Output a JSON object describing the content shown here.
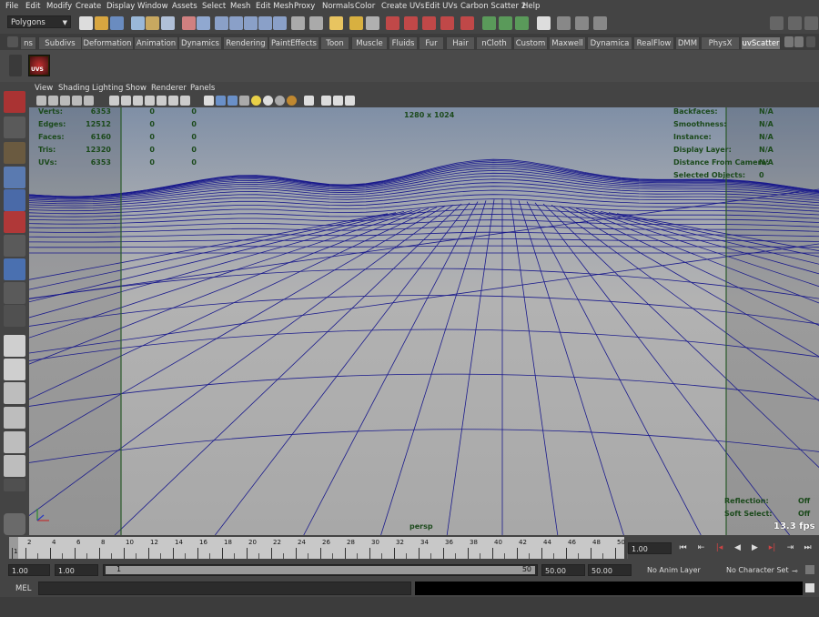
{
  "menubar": {
    "items": [
      "File",
      "Edit",
      "Modify",
      "Create",
      "Display",
      "Window",
      "Assets",
      "Select",
      "Mesh",
      "Edit Mesh",
      "Proxy",
      "Normals",
      "Color",
      "Create UVs",
      "Edit UVs",
      "Carbon Scatter 2",
      "Help"
    ]
  },
  "status": {
    "mode": "Polygons"
  },
  "shelf": {
    "tabs": [
      "ns",
      "Subdivs",
      "Deformation",
      "Animation",
      "Dynamics",
      "Rendering",
      "PaintEffects",
      "Toon",
      "Muscle",
      "Fluids",
      "Fur",
      "Hair",
      "nCloth",
      "Custom",
      "Maxwell",
      "Dynamica",
      "RealFlow",
      "DMM",
      "PhysX",
      "uvScatter"
    ],
    "active_tab": "uvScatter",
    "button_label": "UVS"
  },
  "panel": {
    "menu": [
      "View",
      "Shading",
      "Lighting",
      "Show",
      "Renderer",
      "Panels"
    ]
  },
  "hud": {
    "resolution": "1280 x 1024",
    "left_rows": [
      {
        "label": "Verts:",
        "v1": "6353",
        "v2": "0",
        "v3": "0"
      },
      {
        "label": "Edges:",
        "v1": "12512",
        "v2": "0",
        "v3": "0"
      },
      {
        "label": "Faces:",
        "v1": "6160",
        "v2": "0",
        "v3": "0"
      },
      {
        "label": "Tris:",
        "v1": "12320",
        "v2": "0",
        "v3": "0"
      },
      {
        "label": "UVs:",
        "v1": "6353",
        "v2": "0",
        "v3": "0"
      }
    ],
    "right_rows": [
      {
        "label": "Backfaces:",
        "value": "N/A"
      },
      {
        "label": "Smoothness:",
        "value": "N/A"
      },
      {
        "label": "Instance:",
        "value": "N/A"
      },
      {
        "label": "Display Layer:",
        "value": "N/A"
      },
      {
        "label": "Distance From Camera:",
        "value": "N/A"
      },
      {
        "label": "Selected Objects:",
        "value": "0"
      }
    ],
    "reflection_label": "Reflection:",
    "reflection_value": "Off",
    "softselect_label": "Soft Select:",
    "softselect_value": "Off",
    "fps": "13.3 fps",
    "camera": "persp"
  },
  "timeline": {
    "ticks": [
      "1",
      "2",
      "4",
      "6",
      "8",
      "10",
      "12",
      "14",
      "16",
      "18",
      "20",
      "22",
      "24",
      "26",
      "28",
      "30",
      "32",
      "34",
      "36",
      "38",
      "40",
      "42",
      "44",
      "46",
      "48",
      "50"
    ],
    "current_frame": "1.00"
  },
  "range": {
    "start": "1.00",
    "playback_start": "1.00",
    "slider_start": "1",
    "slider_end": "50",
    "playback_end": "50.00",
    "end": "50.00",
    "anim_layer": "No Anim Layer",
    "character_set": "No Character Set"
  },
  "command": {
    "label": "MEL"
  },
  "colors": {
    "accent": "#5b95c4",
    "wire": "#1a1a8c",
    "hud": "#1c4a1c",
    "viewport_bg_top": "#8a98ab",
    "viewport_bg_bottom": "#a7a7a7"
  }
}
